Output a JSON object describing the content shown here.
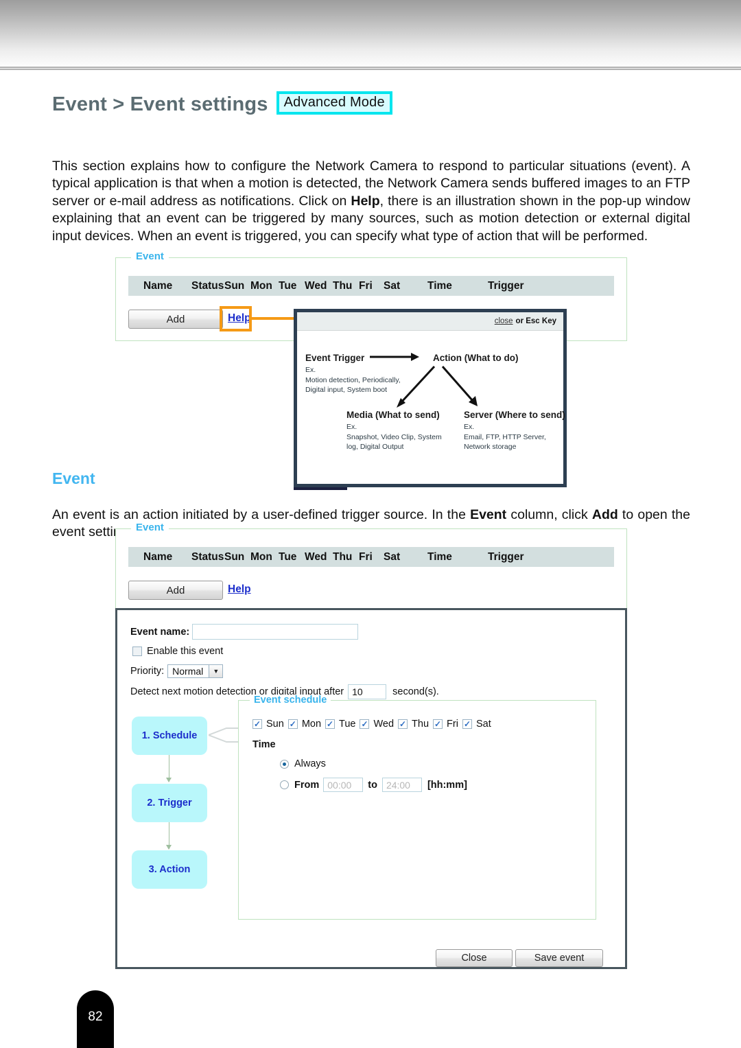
{
  "page": {
    "title_text": "Event > Event settings",
    "badge": "Advanced Mode",
    "number": "82"
  },
  "intro": {
    "p1_a": "This section explains how to configure the Network Camera to respond to particular situations (event). A typical application is that when a motion is detected, the Network Camera sends buffered images to an FTP server or e-mail address as notifications. Click on ",
    "p1_b": "Help",
    "p1_c": ", there is an illustration shown in the pop-up window explaining that an event can be triggered by many sources, such as motion detection or external digital input devices. When an event is triggered, you can specify what type of action that will be performed."
  },
  "section": {
    "heading": "Event",
    "p2_a": "An event is an action initiated by a user-defined trigger source. In the ",
    "p2_b": "Event",
    "p2_c": " column, click ",
    "p2_d": "Add",
    "p2_e": " to open the event settings window."
  },
  "event_panel": {
    "legend": "Event",
    "columns": [
      "Name",
      "Status",
      "Sun",
      "Mon",
      "Tue",
      "Wed",
      "Thu",
      "Fri",
      "Sat",
      "Time",
      "Trigger"
    ],
    "add_button": "Add",
    "help_link": "Help"
  },
  "popup": {
    "close_link": "close",
    "esc_text": "or Esc Key",
    "nodes": {
      "trigger_title": "Event Trigger",
      "trigger_ex": "Ex.",
      "trigger_line1": "Motion detection, Periodically,",
      "trigger_line2": "Digital input, System boot",
      "action_title": "Action (What to do)",
      "media_title": "Media (What to send)",
      "media_ex": "Ex.",
      "media_line1": "Snapshot, Video Clip, System",
      "media_line2": "log, Digital Output",
      "server_title": "Server (Where to send)",
      "server_ex": "Ex.",
      "server_line1": "Email, FTP, HTTP Server,",
      "server_line2": "Network storage"
    }
  },
  "settings": {
    "event_name_label": "Event name:",
    "event_name_value": "",
    "enable_label": "Enable this event",
    "priority_label": "Priority:",
    "priority_value": "Normal",
    "detect_label": "Detect next motion detection or digital input after",
    "detect_value": "10",
    "detect_suffix": "second(s).",
    "steps": [
      "1. Schedule",
      "2. Trigger",
      "3. Action"
    ],
    "schedule": {
      "legend": "Event schedule",
      "days": [
        "Sun",
        "Mon",
        "Tue",
        "Wed",
        "Thu",
        "Fri",
        "Sat"
      ],
      "time_label": "Time",
      "always_label": "Always",
      "from_label": "From",
      "from_value": "00:00",
      "to_label": "to",
      "to_value": "24:00",
      "format_label": "[hh:mm]"
    },
    "close_button": "Close",
    "save_button": "Save event"
  },
  "colors": {
    "title": "#5b6c72",
    "badge_border": "#00e5ee",
    "badge_fill": "#d8fcff",
    "section_heading": "#42b6f0",
    "panel_border": "#bfe3bf",
    "table_head": "#d3dfdf",
    "highlight": "#f59a16",
    "popup_border": "#2d3f52",
    "step_fill": "#b9f7fb",
    "step_text": "#1c2ecb"
  }
}
